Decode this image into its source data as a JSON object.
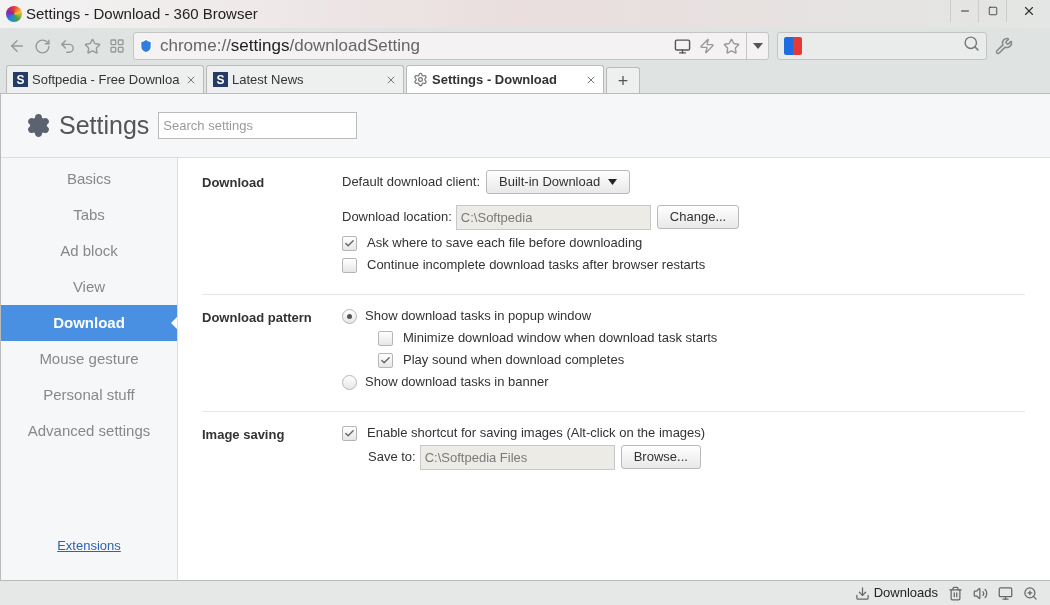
{
  "window": {
    "title": "Settings - Download - 360 Browser"
  },
  "address_bar": {
    "url_prefix": "chrome://",
    "url_main": "settings",
    "url_suffix": "/downloadSetting"
  },
  "tabs": [
    {
      "label": "Softpedia - Free Downloa",
      "kind": "site",
      "favicon": "S",
      "selected": false
    },
    {
      "label": "Latest News",
      "kind": "site",
      "favicon": "S",
      "selected": false
    },
    {
      "label": "Settings - Download",
      "kind": "settings",
      "selected": true
    }
  ],
  "new_tab": "+",
  "settings": {
    "title": "Settings",
    "search_placeholder": "Search settings"
  },
  "sidebar": {
    "items": [
      {
        "label": "Basics",
        "selected": false
      },
      {
        "label": "Tabs",
        "selected": false
      },
      {
        "label": "Ad block",
        "selected": false
      },
      {
        "label": "View",
        "selected": false
      },
      {
        "label": "Download",
        "selected": true
      },
      {
        "label": "Mouse gesture",
        "selected": false
      },
      {
        "label": "Personal stuff",
        "selected": false
      },
      {
        "label": "Advanced settings",
        "selected": false
      }
    ],
    "footer_link": "Extensions"
  },
  "sections": [
    {
      "heading": "Download",
      "rows": [
        {
          "kind": "select",
          "label": "Default download client:",
          "value": "Built-in Download"
        },
        {
          "kind": "path",
          "label": "Download location:",
          "value": "C:\\Softpedia",
          "button": "Change..."
        },
        {
          "kind": "checkbox",
          "label": "Ask where to save each file before downloading",
          "checked": true
        },
        {
          "kind": "checkbox",
          "label": "Continue incomplete download tasks after browser restarts",
          "checked": false
        }
      ]
    },
    {
      "heading": "Download pattern",
      "rows": [
        {
          "kind": "radio",
          "label": "Show download tasks in popup window",
          "selected": true,
          "children": [
            {
              "kind": "checkbox",
              "label": "Minimize download window when download task starts",
              "checked": false
            },
            {
              "kind": "checkbox",
              "label": "Play sound when download completes",
              "checked": true
            }
          ]
        },
        {
          "kind": "radio",
          "label": "Show download tasks in banner",
          "selected": false
        }
      ]
    },
    {
      "heading": "Image saving",
      "rows": [
        {
          "kind": "checkbox",
          "label": "Enable shortcut for saving images (Alt-click on the images)",
          "checked": true
        },
        {
          "kind": "subpath",
          "label": "Save to:",
          "value": "C:\\Softpedia Files",
          "button": "Browse..."
        }
      ]
    }
  ],
  "status_bar": {
    "downloads": "Downloads"
  }
}
